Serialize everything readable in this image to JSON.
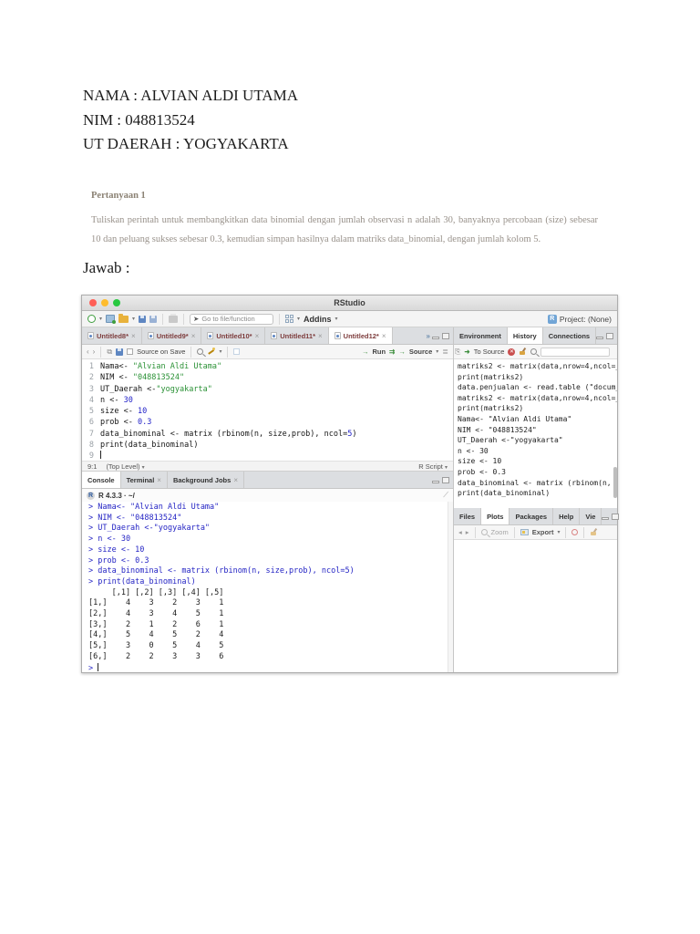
{
  "colors": {
    "string": "#2a9135",
    "number": "#2222c8",
    "console_input": "#2424c4",
    "tab_modified": "#7d3c3c",
    "traffic_red": "#ff5f57",
    "traffic_yellow": "#febc2e",
    "traffic_green": "#28c840"
  },
  "document": {
    "name_line": "NAMA : ALVIAN ALDI UTAMA",
    "nim_line": "NIM : 048813524",
    "region_line": "UT DAERAH : YOGYAKARTA",
    "question_title": "Pertanyaan 1",
    "question_text": "Tuliskan perintah untuk membangkitkan data binomial dengan jumlah observasi n adalah 30, banyaknya percobaan (size) sebesar 10 dan peluang sukses sebesar 0.3, kemudian simpan hasilnya dalam matriks data_binomial, dengan jumlah kolom 5.",
    "answer_label": "Jawab :"
  },
  "rstudio": {
    "window_title": "RStudio",
    "main_toolbar": {
      "goto_placeholder": "Go to file/function",
      "addins_label": "Addins",
      "project_label": "Project: (None)"
    },
    "source_pane": {
      "tabs": [
        "Untitled8*",
        "Untitled9*",
        "Untitled10*",
        "Untitled11*",
        "Untitled12*"
      ],
      "active_tab_index": 4,
      "toolbar": {
        "source_on_save": "Source on Save",
        "run_label": "Run",
        "source_label": "Source"
      },
      "code_lines": [
        [
          [
            "p",
            "Nama<- "
          ],
          [
            "s",
            "\"Alvian Aldi Utama\""
          ]
        ],
        [
          [
            "p",
            "NIM <- "
          ],
          [
            "s",
            "\"048813524\""
          ]
        ],
        [
          [
            "p",
            "UT_Daerah <-"
          ],
          [
            "s",
            "\"yogyakarta\""
          ]
        ],
        [
          [
            "p",
            "n <- "
          ],
          [
            "n",
            "30"
          ]
        ],
        [
          [
            "p",
            "size <- "
          ],
          [
            "n",
            "10"
          ]
        ],
        [
          [
            "p",
            "prob <- "
          ],
          [
            "n",
            "0.3"
          ]
        ],
        [
          [
            "p",
            "data_binominal <- matrix (rbinom(n, size,prob), ncol="
          ],
          [
            "n",
            "5"
          ],
          [
            "p",
            ")"
          ]
        ],
        [
          [
            "p",
            "print(data_binominal)"
          ]
        ],
        []
      ],
      "status_bar": {
        "cursor_position": "9:1",
        "scope": "(Top Level)",
        "file_type": "R Script"
      }
    },
    "console_pane": {
      "tabs": [
        "Console",
        "Terminal",
        "Background Jobs"
      ],
      "active_tab_index": 0,
      "r_version_line": "R 4.3.3 · ~/",
      "commands": [
        "Nama<- \"Alvian Aldi Utama\"",
        "NIM <- \"048813524\"",
        "UT_Daerah <-\"yogyakarta\"",
        "n <- 30",
        "size <- 10",
        "prob <- 0.3",
        "data_binominal <- matrix (rbinom(n, size,prob), ncol=5)",
        "print(data_binominal)"
      ],
      "matrix_output": {
        "col_headers": [
          "[,1]",
          "[,2]",
          "[,3]",
          "[,4]",
          "[,5]"
        ],
        "rows": [
          [
            "[1,]",
            4,
            3,
            2,
            3,
            1
          ],
          [
            "[2,]",
            4,
            3,
            4,
            5,
            1
          ],
          [
            "[3,]",
            2,
            1,
            2,
            6,
            1
          ],
          [
            "[4,]",
            5,
            4,
            5,
            2,
            4
          ],
          [
            "[5,]",
            3,
            0,
            5,
            4,
            5
          ],
          [
            "[6,]",
            2,
            2,
            3,
            3,
            6
          ]
        ]
      },
      "prompt": ">"
    },
    "environment_pane": {
      "tabs": [
        "Environment",
        "History",
        "Connections"
      ],
      "active_tab_index": 1,
      "toolbar": {
        "to_source_label": "To Source"
      },
      "history_items": [
        "matriks2 <- matrix(data,nrow=4,ncol=_",
        "print(matriks2)",
        "data.penjualan <- read.table (\"docum_",
        "matriks2 <- matrix(data,nrow=4,ncol=_",
        "print(matriks2)",
        "Nama<- \"Alvian Aldi Utama\"",
        "NIM <- \"048813524\"",
        "UT_Daerah <-\"yogyakarta\"",
        "n <- 30",
        "size <- 10",
        "prob <- 0.3",
        "data_binominal <- matrix (rbinom(n, _",
        "print(data_binominal)"
      ]
    },
    "files_pane": {
      "tabs": [
        "Files",
        "Plots",
        "Packages",
        "Help",
        "Vie"
      ],
      "active_tab_index": 1,
      "toolbar": {
        "zoom_label": "Zoom",
        "export_label": "Export"
      }
    }
  }
}
